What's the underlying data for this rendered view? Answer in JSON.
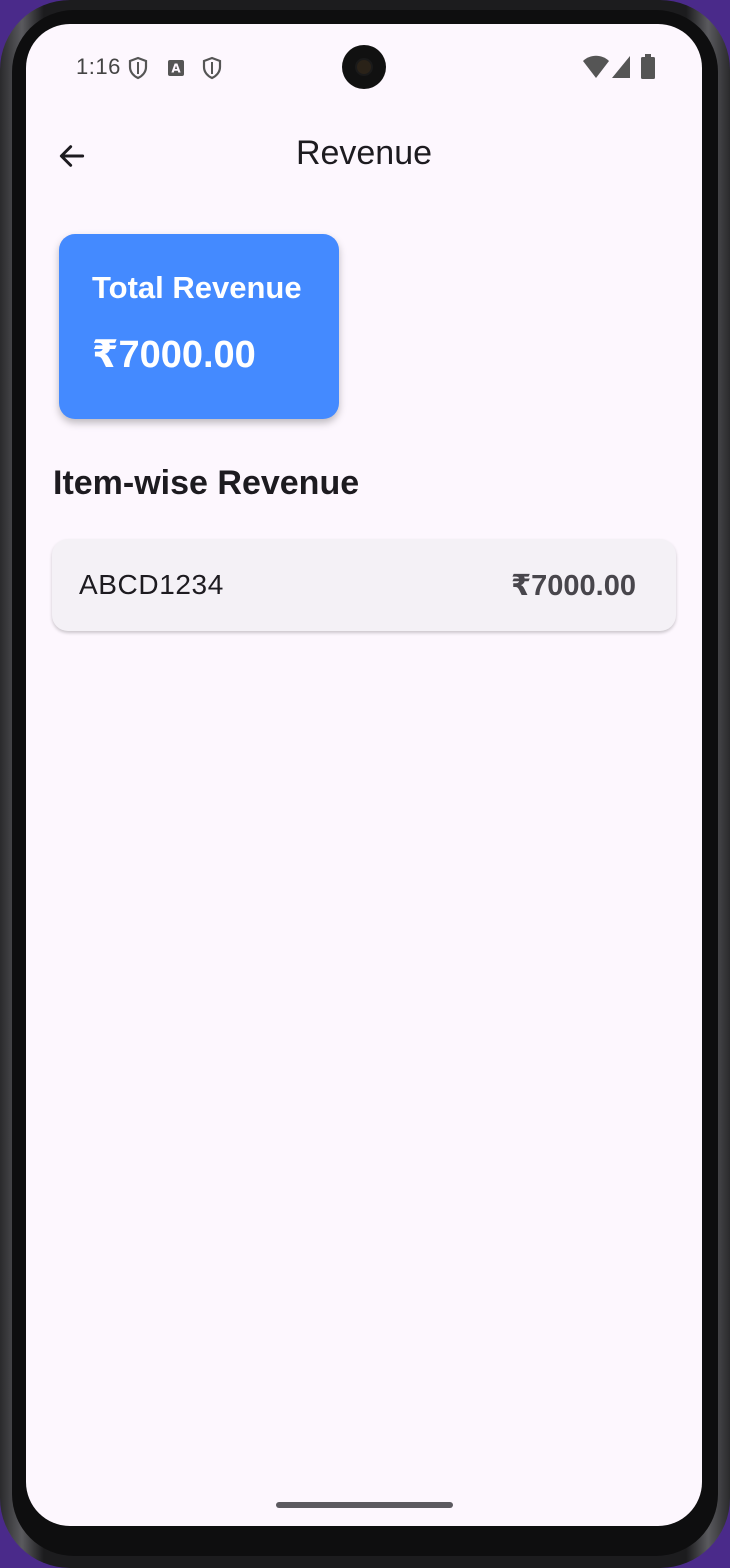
{
  "status_bar": {
    "time": "1:16",
    "left_icons": [
      "shield-icon",
      "a-badge-icon",
      "shield-icon"
    ],
    "right_icons": [
      "wifi-icon",
      "cellular-signal-icon",
      "battery-icon"
    ]
  },
  "app_bar": {
    "title": "Revenue",
    "back_icon": "arrow-back-icon"
  },
  "total_card": {
    "label": "Total Revenue",
    "value": "₹7000.00",
    "color": "#448aff"
  },
  "item_section": {
    "title": "Item-wise Revenue",
    "items": [
      {
        "name": "ABCD1234",
        "value": "₹7000.00"
      }
    ]
  },
  "colors": {
    "background": "#fdf7fe",
    "accent": "#448aff",
    "item_card": "#f4f1f6"
  }
}
